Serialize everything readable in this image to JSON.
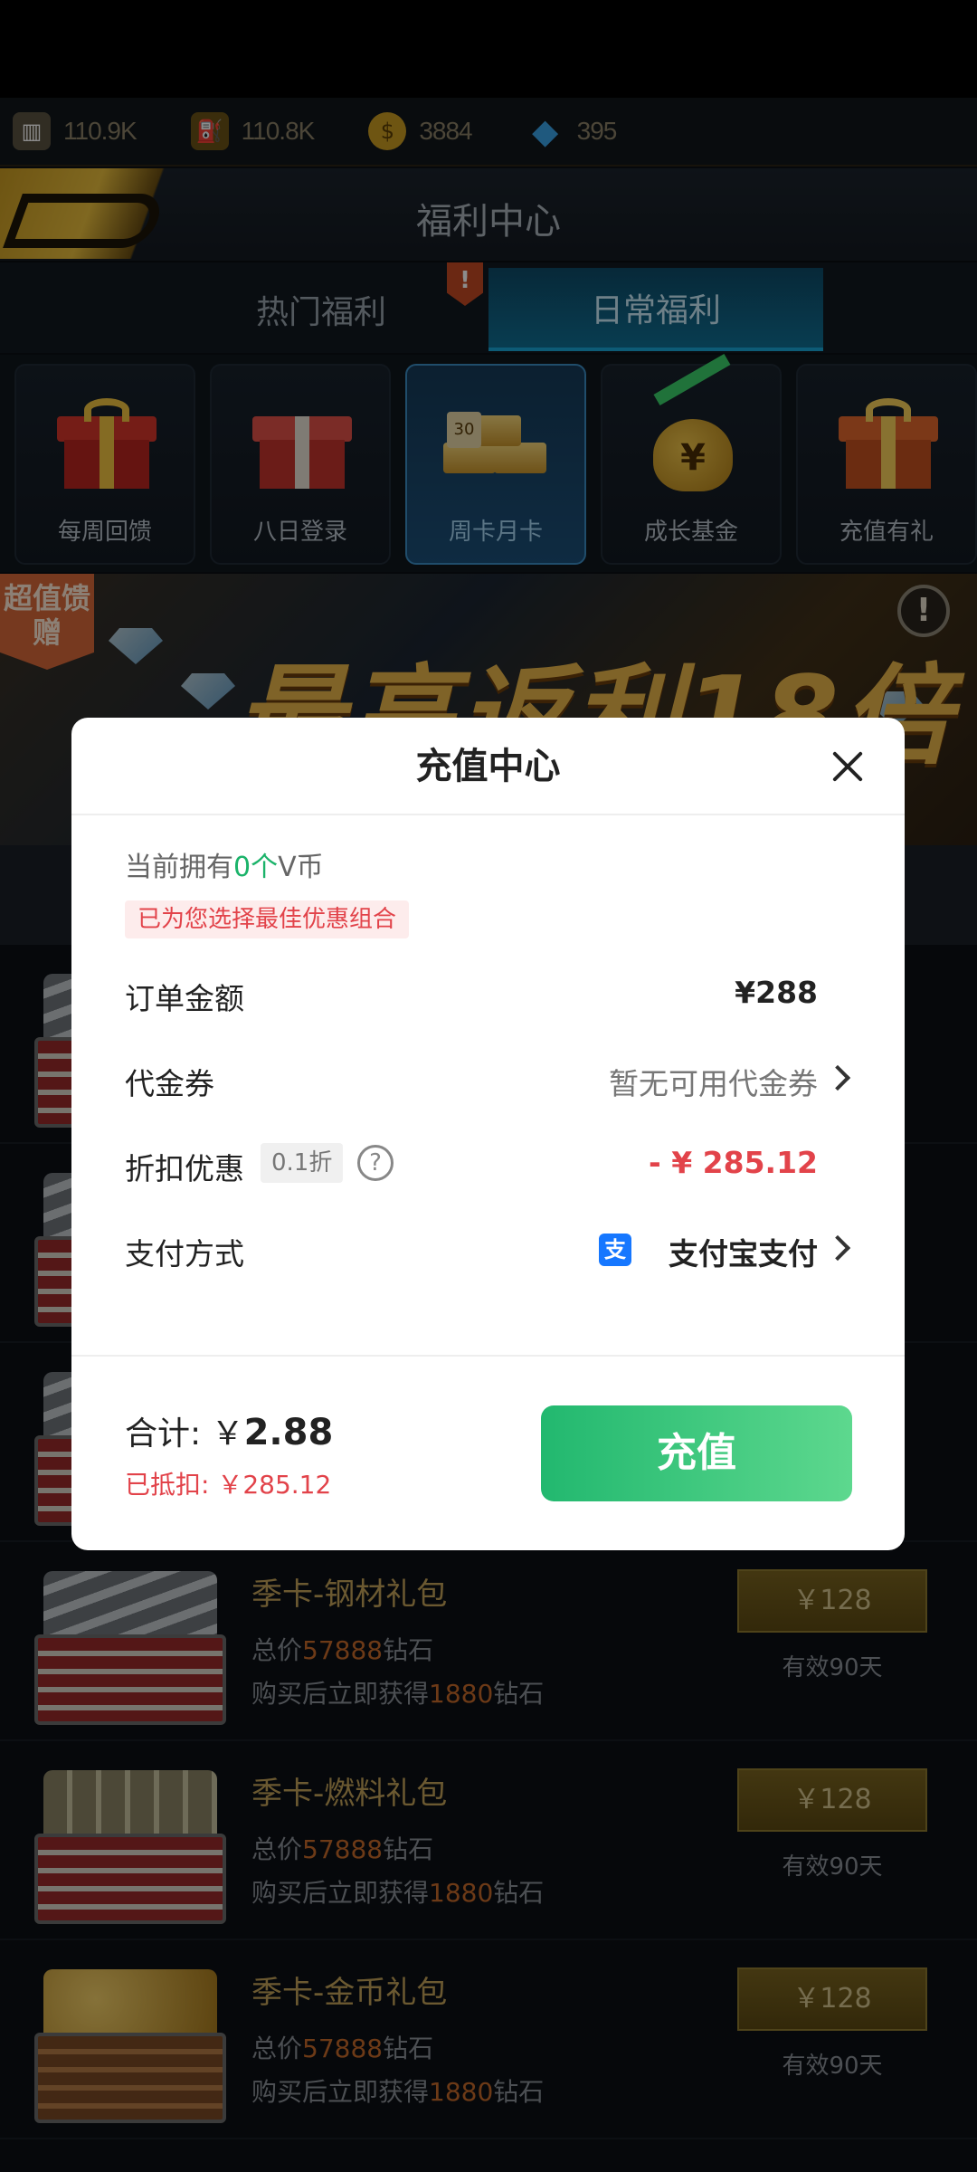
{
  "resources": [
    {
      "icon": "steel-icon",
      "value": "110.9K",
      "color": "#8a7f62"
    },
    {
      "icon": "fuel-icon",
      "value": "110.8K",
      "color": "#b08a2a"
    },
    {
      "icon": "coin-icon",
      "value": "3884",
      "color": "#d5a628"
    },
    {
      "icon": "diamond-icon",
      "value": "395",
      "color": "#3aa2e6"
    }
  ],
  "header": {
    "title": "福利中心"
  },
  "tabs": [
    {
      "label": "热门福利",
      "badge": "!"
    },
    {
      "label": "日常福利",
      "active": true
    }
  ],
  "categories": [
    {
      "label": "每周回馈",
      "icon": "gift-box-icon"
    },
    {
      "label": "八日登录",
      "icon": "gift-stack-icon"
    },
    {
      "label": "周卡月卡",
      "icon": "gold-bars-icon",
      "active": true
    },
    {
      "label": "成长基金",
      "icon": "money-bag-icon"
    },
    {
      "label": "充值有礼",
      "icon": "gift-hand-icon"
    }
  ],
  "banner": {
    "tag": "超值馈赠",
    "text": "最高返利18倍"
  },
  "items": [
    {
      "title": "季卡-钢材礼包",
      "total_prefix": "总价",
      "total_value": "57888",
      "total_suffix": "钻石",
      "bonus_prefix": "购买后立即获得",
      "bonus_value": "1880",
      "bonus_suffix": "钻石",
      "price": "￥128",
      "valid": "有效90天"
    },
    {
      "title": "季卡-燃料礼包",
      "total_prefix": "总价",
      "total_value": "57888",
      "total_suffix": "钻石",
      "bonus_prefix": "购买后立即获得",
      "bonus_value": "1880",
      "bonus_suffix": "钻石",
      "price": "￥128",
      "valid": "有效90天"
    },
    {
      "title": "季卡-金币礼包",
      "total_prefix": "总价",
      "total_value": "57888",
      "total_suffix": "钻石",
      "bonus_prefix": "购买后立即获得",
      "bonus_value": "1880",
      "bonus_suffix": "钻石",
      "price": "￥128",
      "valid": "有效90天"
    }
  ],
  "modal": {
    "title": "充值中心",
    "balance_prefix": "当前拥有",
    "balance_value": "0个",
    "balance_suffix": "V币",
    "best_combo": "已为您选择最佳优惠组合",
    "order_label": "订单金额",
    "order_amount": "¥288",
    "voucher_label": "代金券",
    "voucher_value": "暂无可用代金券",
    "discount_label": "折扣优惠",
    "discount_tag": "0.1折",
    "discount_amount": "- ¥ 285.12",
    "pay_label": "支付方式",
    "pay_method": "支付宝支付",
    "total_prefix": "合计: ￥",
    "total_value": "2.88",
    "deducted": "已抵扣: ￥285.12",
    "recharge_button": "充值"
  }
}
